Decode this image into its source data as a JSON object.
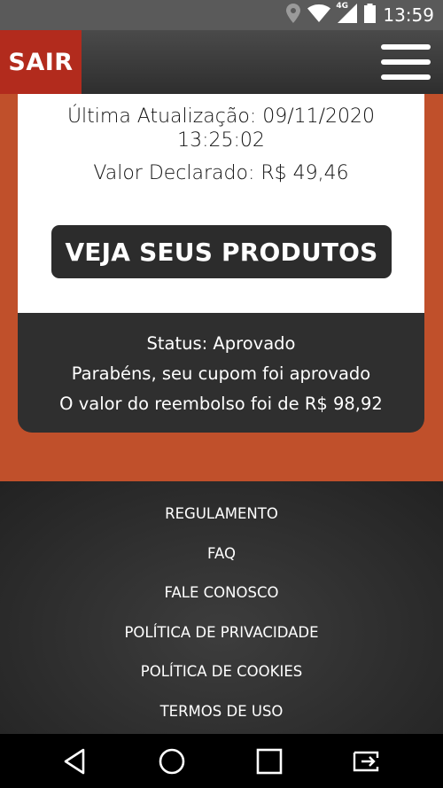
{
  "status_bar": {
    "time": "13:59",
    "network": "4G"
  },
  "header": {
    "exit_label": "SAIR"
  },
  "card": {
    "last_update_line1": "Última Atualização: 09/11/2020",
    "last_update_line2": "13:25:02",
    "declared_value": "Valor Declarado: R$ 49,46",
    "button_label": "VEJA SEUS PRODUTOS"
  },
  "status_panel": {
    "status": "Status: Aprovado",
    "message": "Parabéns, seu cupom foi aprovado",
    "refund": "O valor do reembolso foi de R$ 98,92"
  },
  "footer": {
    "links": [
      "REGULAMENTO",
      "FAQ",
      "FALE CONOSCO",
      "POLÍTICA DE PRIVACIDADE",
      "POLÍTICA DE COOKIES",
      "TERMOS DE USO"
    ]
  },
  "icons": {
    "location": "location-icon",
    "wifi": "wifi-icon",
    "signal": "signal-icon",
    "battery": "battery-icon",
    "menu": "hamburger-menu-icon",
    "back": "back-icon",
    "home": "home-icon",
    "recents": "recents-icon",
    "cast": "screen-cast-icon"
  },
  "colors": {
    "brand_orange": "#c0502b",
    "exit_red": "#b22b1d",
    "dark": "#2f2f2f"
  }
}
